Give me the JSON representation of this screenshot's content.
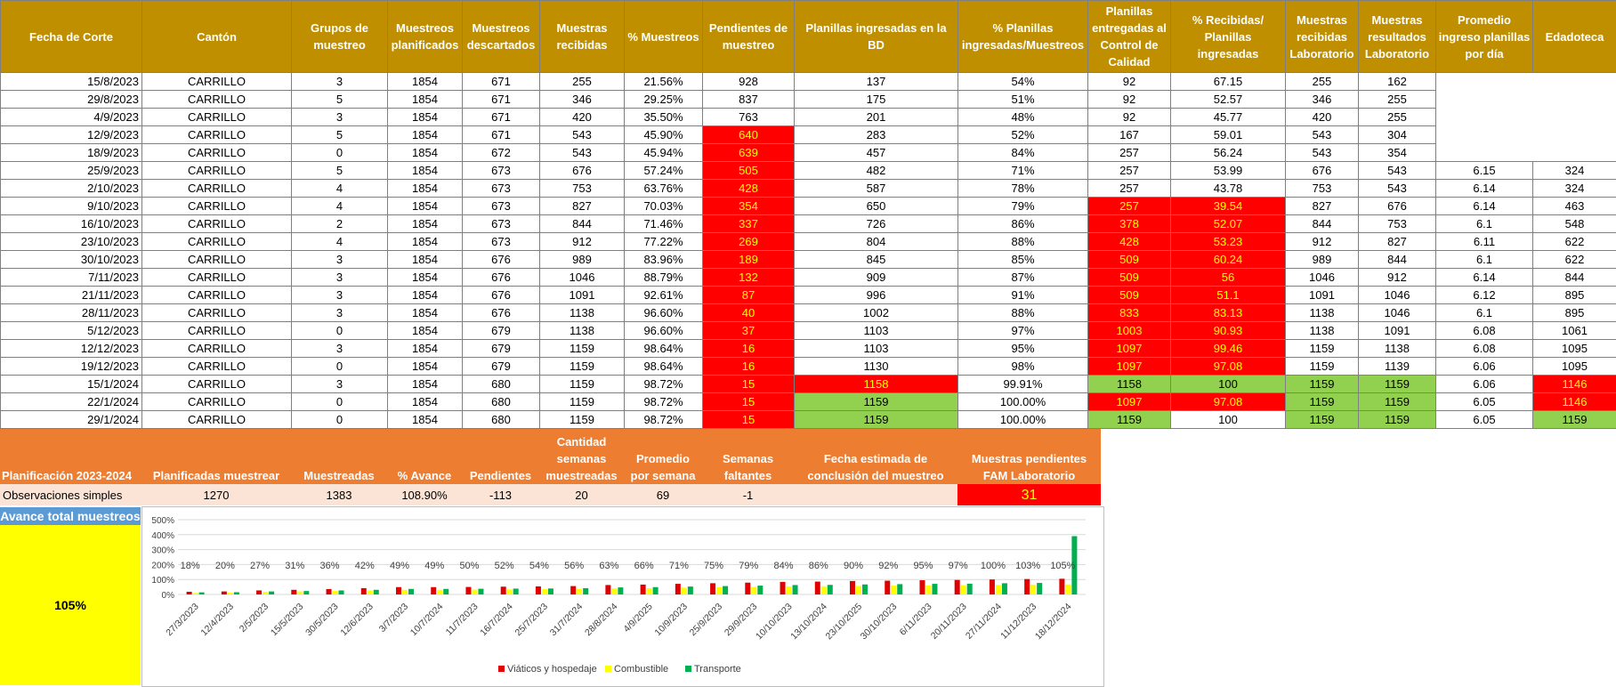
{
  "headers": [
    "Fecha de Corte",
    "Cantón",
    "Grupos de muestreo",
    "Muestreos planificados",
    "Muestreos descartados",
    "Muestras recibidas",
    "% Muestreos",
    "Pendientes de muestreo",
    "Planillas ingresadas en la BD",
    "% Planillas ingresadas/Muestreos",
    "Planillas entregadas al Control de Calidad",
    "% Recibidas/ Planillas ingresadas",
    "Muestras recibidas Laboratorio",
    "Muestras resultados Laboratorio",
    "Promedio ingreso planillas por día",
    "Edadoteca"
  ],
  "rows": [
    [
      "15/8/2023",
      "CARRILLO",
      "3",
      "1854",
      "671",
      "255",
      "21.56%",
      "928",
      "137",
      "54%",
      "92",
      "67.15",
      "255",
      "162",
      "",
      ""
    ],
    [
      "29/8/2023",
      "CARRILLO",
      "5",
      "1854",
      "671",
      "346",
      "29.25%",
      "837",
      "175",
      "51%",
      "92",
      "52.57",
      "346",
      "255",
      "",
      ""
    ],
    [
      "4/9/2023",
      "CARRILLO",
      "3",
      "1854",
      "671",
      "420",
      "35.50%",
      "763",
      "201",
      "48%",
      "92",
      "45.77",
      "420",
      "255",
      "",
      ""
    ],
    [
      "12/9/2023",
      "CARRILLO",
      "5",
      "1854",
      "671",
      "543",
      "45.90%",
      "640",
      "283",
      "52%",
      "167",
      "59.01",
      "543",
      "304",
      "",
      ""
    ],
    [
      "18/9/2023",
      "CARRILLO",
      "0",
      "1854",
      "672",
      "543",
      "45.94%",
      "639",
      "457",
      "84%",
      "257",
      "56.24",
      "543",
      "354",
      "",
      ""
    ],
    [
      "25/9/2023",
      "CARRILLO",
      "5",
      "1854",
      "673",
      "676",
      "57.24%",
      "505",
      "482",
      "71%",
      "257",
      "53.99",
      "676",
      "543",
      "6.15",
      "324"
    ],
    [
      "2/10/2023",
      "CARRILLO",
      "4",
      "1854",
      "673",
      "753",
      "63.76%",
      "428",
      "587",
      "78%",
      "257",
      "43.78",
      "753",
      "543",
      "6.14",
      "324"
    ],
    [
      "9/10/2023",
      "CARRILLO",
      "4",
      "1854",
      "673",
      "827",
      "70.03%",
      "354",
      "650",
      "79%",
      "257",
      "39.54",
      "827",
      "676",
      "6.14",
      "463"
    ],
    [
      "16/10/2023",
      "CARRILLO",
      "2",
      "1854",
      "673",
      "844",
      "71.46%",
      "337",
      "726",
      "86%",
      "378",
      "52.07",
      "844",
      "753",
      "6.1",
      "548"
    ],
    [
      "23/10/2023",
      "CARRILLO",
      "4",
      "1854",
      "673",
      "912",
      "77.22%",
      "269",
      "804",
      "88%",
      "428",
      "53.23",
      "912",
      "827",
      "6.11",
      "622"
    ],
    [
      "30/10/2023",
      "CARRILLO",
      "3",
      "1854",
      "676",
      "989",
      "83.96%",
      "189",
      "845",
      "85%",
      "509",
      "60.24",
      "989",
      "844",
      "6.1",
      "622"
    ],
    [
      "7/11/2023",
      "CARRILLO",
      "3",
      "1854",
      "676",
      "1046",
      "88.79%",
      "132",
      "909",
      "87%",
      "509",
      "56",
      "1046",
      "912",
      "6.14",
      "844"
    ],
    [
      "21/11/2023",
      "CARRILLO",
      "3",
      "1854",
      "676",
      "1091",
      "92.61%",
      "87",
      "996",
      "91%",
      "509",
      "51.1",
      "1091",
      "1046",
      "6.12",
      "895"
    ],
    [
      "28/11/2023",
      "CARRILLO",
      "3",
      "1854",
      "676",
      "1138",
      "96.60%",
      "40",
      "1002",
      "88%",
      "833",
      "83.13",
      "1138",
      "1046",
      "6.1",
      "895"
    ],
    [
      "5/12/2023",
      "CARRILLO",
      "0",
      "1854",
      "679",
      "1138",
      "96.60%",
      "37",
      "1103",
      "97%",
      "1003",
      "90.93",
      "1138",
      "1091",
      "6.08",
      "1061"
    ],
    [
      "12/12/2023",
      "CARRILLO",
      "3",
      "1854",
      "679",
      "1159",
      "98.64%",
      "16",
      "1103",
      "95%",
      "1097",
      "99.46",
      "1159",
      "1138",
      "6.08",
      "1095"
    ],
    [
      "19/12/2023",
      "CARRILLO",
      "0",
      "1854",
      "679",
      "1159",
      "98.64%",
      "16",
      "1130",
      "98%",
      "1097",
      "97.08",
      "1159",
      "1139",
      "6.06",
      "1095"
    ],
    [
      "15/1/2024",
      "CARRILLO",
      "3",
      "1854",
      "680",
      "1159",
      "98.72%",
      "15",
      "1158",
      "99.91%",
      "1158",
      "100",
      "1159",
      "1159",
      "6.06",
      "1146"
    ],
    [
      "22/1/2024",
      "CARRILLO",
      "0",
      "1854",
      "680",
      "1159",
      "98.72%",
      "15",
      "1159",
      "100.00%",
      "1097",
      "97.08",
      "1159",
      "1159",
      "6.05",
      "1146"
    ],
    [
      "29/1/2024",
      "CARRILLO",
      "0",
      "1854",
      "680",
      "1159",
      "98.72%",
      "15",
      "1159",
      "100.00%",
      "1159",
      "100",
      "1159",
      "1159",
      "6.05",
      "1159"
    ]
  ],
  "planning": {
    "headers": [
      "Planificación 2023-2024",
      "Planificadas muestrear",
      "Muestreadas",
      "% Avance",
      "Pendientes",
      "Cantidad semanas muestreadas",
      "Promedio por semana",
      "Semanas faltantes",
      "Fecha estimada de conclusión del muestreo",
      "Muestras pendientes FAM Laboratorio"
    ],
    "row": [
      "Observaciones simples",
      "1270",
      "1383",
      "108.90%",
      "-113",
      "20",
      "69",
      "-1",
      "",
      "31"
    ]
  },
  "avance": {
    "label": "Avance total muestreos",
    "value": "105%"
  },
  "colors": {
    "header": "#bf8f00",
    "planning_header": "#ed7d31",
    "planning_row": "#fbe4d5",
    "alert_red": "#ff0000",
    "ok_green": "#92d050",
    "highlight_yellow": "#ffff00",
    "series_red": "#e00000",
    "series_yellow": "#ffff00",
    "series_green": "#00b050"
  },
  "chart_data": {
    "type": "bar",
    "categories": [
      "27/3/2023",
      "12/4/2023",
      "2/5/2023",
      "15/5/2023",
      "30/5/2023",
      "12/6/2023",
      "3/7/2023",
      "10/7/2024",
      "11/7/2023",
      "16/7/2024",
      "25/7/2023",
      "31/7/2024",
      "28/8/2024",
      "4/9/2025",
      "10/9/2023",
      "25/9/2023",
      "29/9/2023",
      "10/10/2023",
      "13/10/2024",
      "23/10/2025",
      "30/10/2023",
      "6/11/2023",
      "20/11/2023",
      "27/11/2024",
      "11/12/2023",
      "18/12/2024"
    ],
    "series": [
      {
        "name": "Viáticos y hospedaje",
        "values": [
          18,
          20,
          27,
          31,
          36,
          42,
          49,
          49,
          50,
          52,
          54,
          56,
          63,
          66,
          71,
          75,
          79,
          84,
          86,
          90,
          92,
          95,
          97,
          100,
          103,
          105
        ]
      },
      {
        "name": "Combustible",
        "values": [
          10,
          12,
          17,
          20,
          23,
          27,
          31,
          31,
          32,
          33,
          35,
          36,
          40,
          42,
          45,
          48,
          50,
          54,
          55,
          57,
          59,
          61,
          62,
          64,
          66,
          67
        ]
      },
      {
        "name": "Transporte",
        "values": [
          14,
          15,
          20,
          23,
          27,
          31,
          37,
          37,
          38,
          39,
          40,
          42,
          47,
          49,
          53,
          56,
          59,
          63,
          64,
          67,
          69,
          71,
          72,
          75,
          77,
          390
        ]
      }
    ],
    "data_labels": [
      "18%",
      "20%",
      "27%",
      "31%",
      "36%",
      "42%",
      "49%",
      "49%",
      "50%",
      "52%",
      "54%",
      "56%",
      "63%",
      "66%",
      "71%",
      "75%",
      "79%",
      "84%",
      "86%",
      "90%",
      "92%",
      "95%",
      "97%",
      "100%",
      "103%",
      "105%"
    ],
    "ytick_labels": [
      "0%",
      "100%",
      "200%",
      "300%",
      "400%",
      "500%"
    ],
    "ylim": [
      0,
      500
    ],
    "grid": true,
    "legend": "bottom"
  }
}
